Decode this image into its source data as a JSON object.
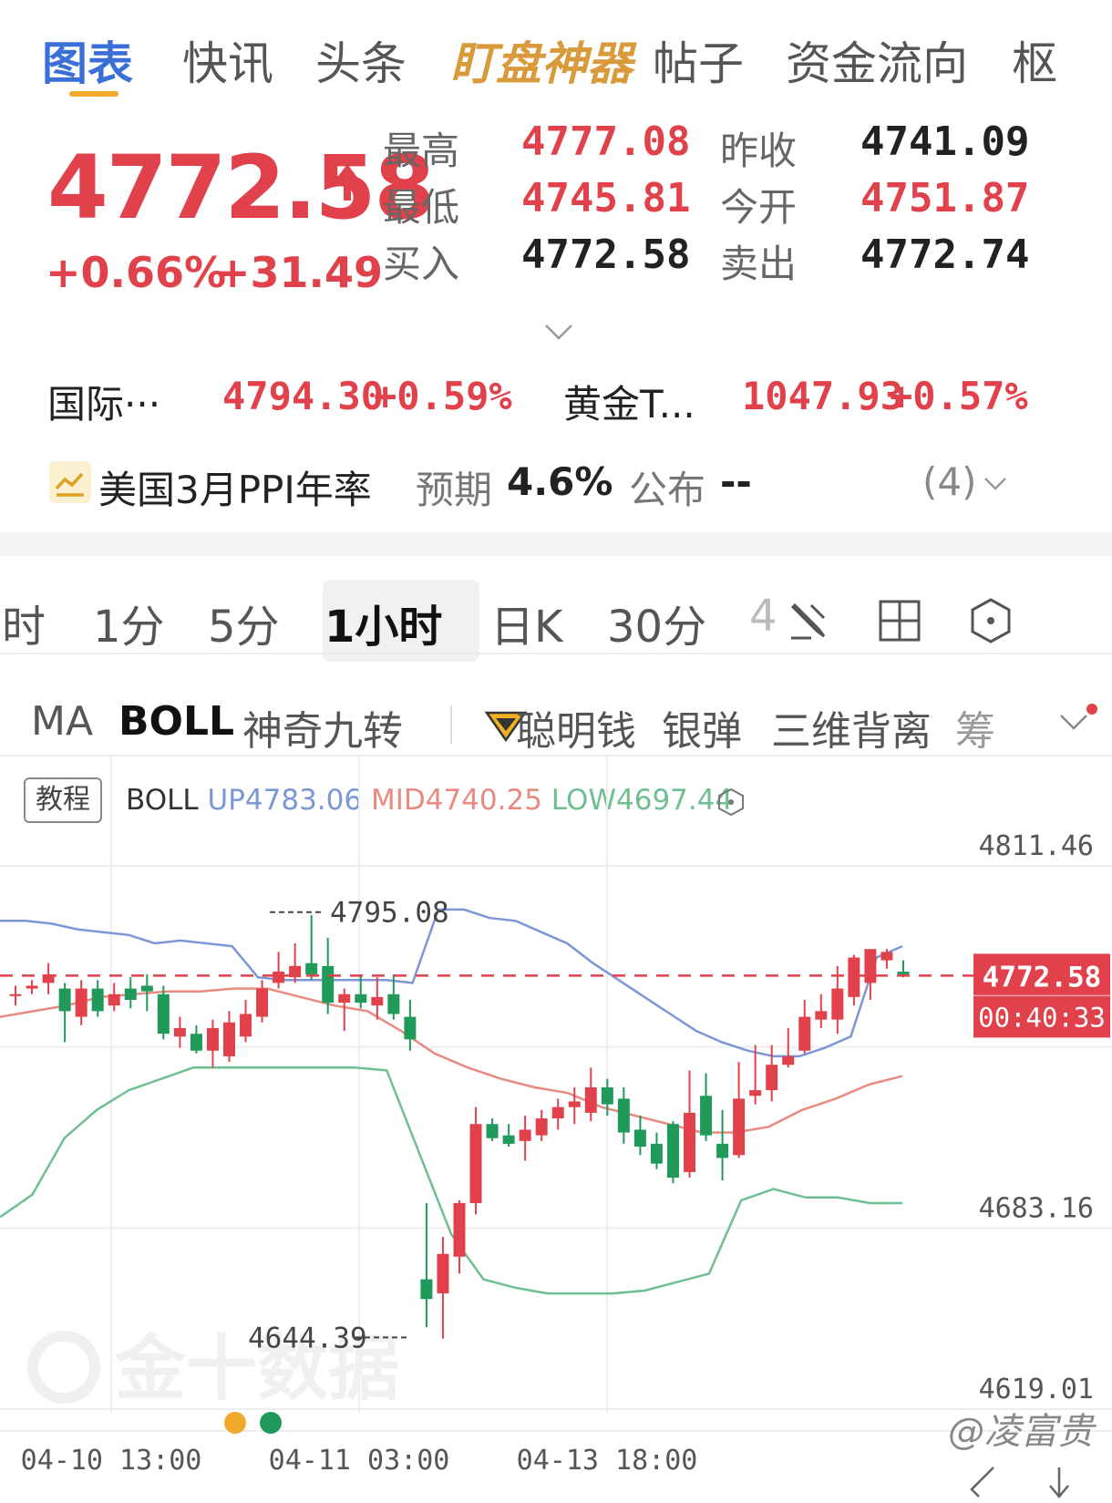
{
  "top_tabs": [
    {
      "label": "图表",
      "active": true
    },
    {
      "label": "快讯"
    },
    {
      "label": "头条"
    },
    {
      "label": "盯盘神器"
    },
    {
      "label": "帖子"
    },
    {
      "label": "资金流向"
    },
    {
      "label": "枢"
    }
  ],
  "quote": {
    "price": "4772.58",
    "change_pct": "+0.66%",
    "change_abs": "+31.49",
    "high_label": "最高",
    "high": "4777.08",
    "low_label": "最低",
    "low": "4745.81",
    "bid_label": "买入",
    "bid": "4772.58",
    "prev_close_label": "昨收",
    "prev_close": "4741.09",
    "open_label": "今开",
    "open": "4751.87",
    "ask_label": "卖出",
    "ask": "4772.74"
  },
  "related": [
    {
      "name": "国际···",
      "price": "4794.30",
      "change": "+0.59%"
    },
    {
      "name": "黄金T...",
      "price": "1047.93",
      "change": "+0.57%"
    }
  ],
  "event": {
    "title": "美国3月PPI年率",
    "expected_label": "预期",
    "expected": "4.6%",
    "actual_label": "公布",
    "actual": "--",
    "count": "(4)"
  },
  "periods": [
    {
      "label": "时"
    },
    {
      "label": "1分"
    },
    {
      "label": "5分"
    },
    {
      "label": "1小时",
      "active": true
    },
    {
      "label": "日K"
    },
    {
      "label": "30分"
    },
    {
      "label": "4"
    }
  ],
  "indicators": [
    {
      "label": "MA"
    },
    {
      "label": "BOLL",
      "active": true
    },
    {
      "label": "神奇九转"
    },
    {
      "label": "聪明钱"
    },
    {
      "label": "银弹"
    },
    {
      "label": "三维背离"
    },
    {
      "label": "筹"
    }
  ],
  "legend": {
    "tutorial": "教程",
    "name": "BOLL",
    "up": "UP4783.06",
    "mid": "MID4740.25",
    "low": "LOW4697.44"
  },
  "colors": {
    "up": "#e0414a",
    "down": "#1f9a5a",
    "boll_up": "#7b97d8",
    "boll_mid": "#e88a80",
    "boll_low": "#6fbf92",
    "accent": "#3a6fd8",
    "gold": "#d89a3a"
  },
  "chart_data": {
    "type": "candlestick",
    "y_axis_labels": [
      "4811.46",
      "4683.16",
      "4619.01"
    ],
    "x_axis_labels": [
      "04-10 13:00",
      "04-11 03:00",
      "04-13 18:00"
    ],
    "annotations": {
      "period_high": "4795.08",
      "period_low": "4644.39"
    },
    "current_price": "4772.58",
    "countdown": "00:40:33",
    "watermark": "金十数据",
    "credit": "@凌富贵",
    "ylim": [
      4619.01,
      4811.46
    ],
    "candles": [
      [
        4766,
        4766,
        4769,
        4762
      ],
      [
        4768,
        4769,
        4771,
        4766
      ],
      [
        4770,
        4773,
        4777,
        4766
      ],
      [
        4768,
        4760,
        4770,
        4749
      ],
      [
        4758,
        4768,
        4771,
        4755
      ],
      [
        4768,
        4760,
        4771,
        4758
      ],
      [
        4762,
        4766,
        4770,
        4760
      ],
      [
        4768,
        4764,
        4772,
        4761
      ],
      [
        4769,
        4767,
        4773,
        4760
      ],
      [
        4766,
        4752,
        4769,
        4750
      ],
      [
        4751,
        4754,
        4758,
        4747
      ],
      [
        4752,
        4746,
        4755,
        4745
      ],
      [
        4746,
        4754,
        4757,
        4740
      ],
      [
        4744,
        4756,
        4760,
        4742
      ],
      [
        4751,
        4759,
        4764,
        4749
      ],
      [
        4758,
        4768,
        4771,
        4756
      ],
      [
        4770,
        4774,
        4781,
        4768
      ],
      [
        4772,
        4776,
        4784,
        4770
      ],
      [
        4777,
        4773,
        4794,
        4771
      ],
      [
        4776,
        4763,
        4786,
        4759
      ],
      [
        4763,
        4766,
        4768,
        4753
      ],
      [
        4766,
        4763,
        4773,
        4761
      ],
      [
        4762,
        4765,
        4772,
        4757
      ],
      [
        4766,
        4759,
        4773,
        4757
      ],
      [
        4758,
        4750,
        4764,
        4746
      ],
      [
        4665,
        4658,
        4692,
        4648
      ],
      [
        4660,
        4674,
        4680,
        4644
      ],
      [
        4673,
        4692,
        4693,
        4667
      ],
      [
        4692,
        4720,
        4726,
        4688
      ],
      [
        4720,
        4715,
        4722,
        4714
      ],
      [
        4716,
        4713,
        4720,
        4712
      ],
      [
        4714,
        4718,
        4723,
        4707
      ],
      [
        4716,
        4722,
        4725,
        4714
      ],
      [
        4722,
        4726,
        4729,
        4718
      ],
      [
        4726,
        4728,
        4733,
        4720
      ],
      [
        4724,
        4733,
        4740,
        4721
      ],
      [
        4733,
        4727,
        4736,
        4723
      ],
      [
        4729,
        4717,
        4733,
        4713
      ],
      [
        4718,
        4712,
        4723,
        4709
      ],
      [
        4713,
        4706,
        4717,
        4704
      ],
      [
        4720,
        4701,
        4721,
        4699
      ],
      [
        4703,
        4724,
        4739,
        4701
      ],
      [
        4730,
        4716,
        4738,
        4714
      ],
      [
        4713,
        4708,
        4725,
        4700
      ],
      [
        4709,
        4729,
        4742,
        4708
      ],
      [
        4730,
        4732,
        4748,
        4727
      ],
      [
        4732,
        4741,
        4748,
        4728
      ],
      [
        4741,
        4744,
        4754,
        4740
      ],
      [
        4746,
        4758,
        4764,
        4745
      ],
      [
        4757,
        4760,
        4766,
        4754
      ],
      [
        4757,
        4768,
        4776,
        4752
      ],
      [
        4765,
        4779,
        4780,
        4762
      ],
      [
        4770,
        4782,
        4781,
        4764
      ],
      [
        4778,
        4781,
        4782,
        4775
      ],
      [
        4774,
        4773,
        4778,
        4772
      ]
    ],
    "boll_up": [
      4792,
      4792,
      4791,
      4789,
      4788,
      4787,
      4784,
      4785,
      4784,
      4783,
      4772,
      4771,
      4771,
      4771,
      4771,
      4771,
      4770,
      4796,
      4796,
      4793,
      4792,
      4788,
      4784,
      4777,
      4771,
      4765,
      4759,
      4753,
      4749,
      4746,
      4744,
      4744,
      4747,
      4751,
      4779,
      4783
    ],
    "boll_mid": [
      4758,
      4760,
      4762,
      4765,
      4766,
      4767,
      4767,
      4768,
      4768,
      4765,
      4762,
      4760,
      4753,
      4745,
      4740,
      4736,
      4733,
      4731,
      4726,
      4723,
      4720,
      4717,
      4717,
      4719,
      4725,
      4729,
      4734,
      4737
    ],
    "boll_low": [
      4687,
      4695,
      4715,
      4725,
      4732,
      4736,
      4740,
      4740,
      4740,
      4740,
      4740,
      4740,
      4739,
      4710,
      4681,
      4665,
      4662,
      4660,
      4660,
      4660,
      4661,
      4664,
      4667,
      4693,
      4697,
      4694,
      4694,
      4692,
      4692
    ]
  }
}
